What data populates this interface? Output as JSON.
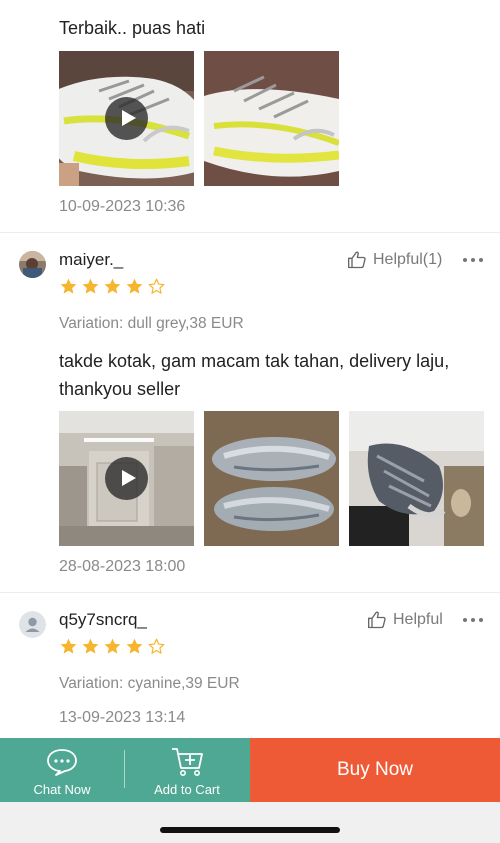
{
  "reviews": [
    {
      "comment": "Terbaik.. puas hati",
      "media": [
        {
          "type": "video",
          "subject": "white-yellow sneaker"
        },
        {
          "type": "image",
          "subject": "white-yellow sneaker"
        }
      ],
      "date": "10-09-2023 10:36"
    },
    {
      "username": "maiyer._",
      "rating": 4,
      "helpful_label": "Helpful(1)",
      "variation": "Variation: dull grey,38 EUR",
      "comment": "takde kotak, gam macam tak tahan, delivery laju, thankyou seller",
      "comment_lines": [
        "takde kotak, gam macam tak tahan, delivery laju,",
        "thankyou seller"
      ],
      "media": [
        {
          "type": "video",
          "subject": "room corridor"
        },
        {
          "type": "image",
          "subject": "grey sneakers pair"
        },
        {
          "type": "image",
          "subject": "grey sneaker worn"
        }
      ],
      "date": "28-08-2023 18:00"
    },
    {
      "username": "q5y7sncrq_",
      "rating": 4,
      "helpful_label": "Helpful",
      "variation": "Variation: cyanine,39 EUR",
      "date": "13-09-2023 13:14"
    }
  ],
  "bottom_bar": {
    "chat_label": "Chat Now",
    "cart_label": "Add to Cart",
    "buy_label": "Buy Now"
  },
  "colors": {
    "green": "#4ea893",
    "orange": "#ee5a36",
    "star": "#f6b52e"
  },
  "icons": [
    "play-icon",
    "thumb-up-icon",
    "more-icon",
    "star-icon",
    "chat-icon",
    "cart-plus-icon",
    "avatar-placeholder-icon"
  ]
}
